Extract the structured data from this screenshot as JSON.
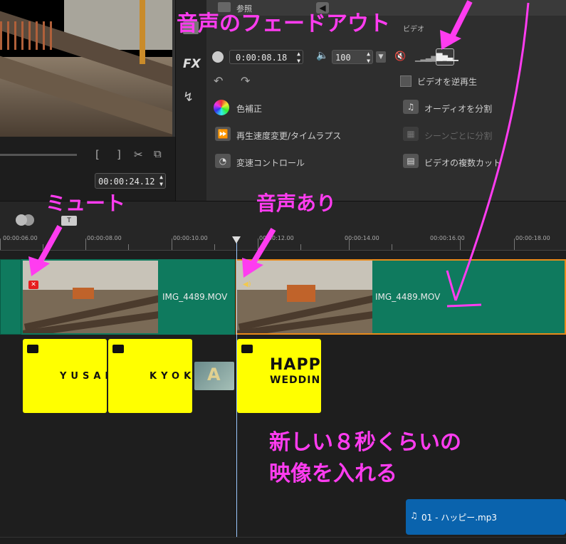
{
  "preview": {
    "timecode": "00:00:24.12",
    "mark_in": "[",
    "mark_out": "]"
  },
  "side_tools": {
    "fx": "FX"
  },
  "options": {
    "top_tab": "参照",
    "section": "ビデオ",
    "duration": "0:00:08.18",
    "volume": "100",
    "reverse": "ビデオを逆再生",
    "color_correction": "色補正",
    "split_audio": "オーディオを分割",
    "speed": "再生速度変更/タイムラプス",
    "scene_split": "シーンごとに分割",
    "variable_speed": "変速コントロール",
    "multi_trim": "ビデオの複数カット"
  },
  "ruler": {
    "labels": [
      "00:00:06.00",
      "00:00:08.00",
      "00:00:10.00",
      "00:00:12.00",
      "00:00:14.00",
      "00:00:16.00",
      "00:00:18.00"
    ]
  },
  "timeline": {
    "clip1_name": "IMG_4489.MOV",
    "clip2_name": "IMG_4489.MOV",
    "title1": "YUSAK",
    "title2": "KYOKO",
    "title3_line1": "HAPP",
    "title3_line2": "WEDDIN",
    "audio_name": "01 - ハッピー.mp3"
  },
  "annotations": {
    "fade_out": "音声のフェードアウト",
    "mute": "ミュート",
    "has_audio": "音声あり",
    "insert_line1": "新しい８秒くらいの",
    "insert_line2": "映像を入れる"
  },
  "colors": {
    "annotation": "#ff3cf0",
    "video_clip": "#0f7a5e",
    "title_clip": "#ffff00",
    "audio_clip": "#0a63ad"
  }
}
